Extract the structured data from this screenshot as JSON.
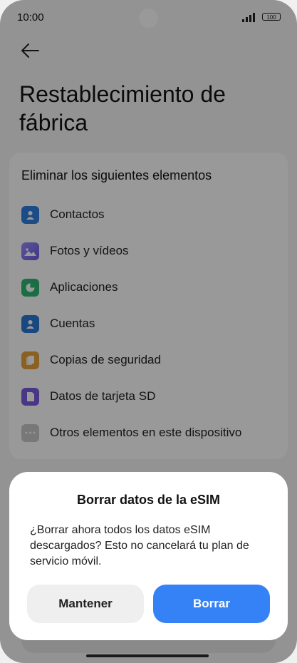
{
  "status_bar": {
    "time": "10:00",
    "battery": "100"
  },
  "header": {
    "title": "Restablecimiento de fábrica"
  },
  "card": {
    "title": "Eliminar los siguientes elementos",
    "items": [
      {
        "label": "Contactos",
        "icon": "contact-icon",
        "color": "#2f7fe0"
      },
      {
        "label": "Fotos y vídeos",
        "icon": "gallery-icon",
        "color": "#7b6df0"
      },
      {
        "label": "Aplicaciones",
        "icon": "apps-pie-icon",
        "color": "#2eb872"
      },
      {
        "label": "Cuentas",
        "icon": "account-icon",
        "color": "#2a78d6"
      },
      {
        "label": "Copias de seguridad",
        "icon": "backup-icon",
        "color": "#e8a23a"
      },
      {
        "label": "Datos de tarjeta SD",
        "icon": "sd-card-icon",
        "color": "#7a5ae0"
      },
      {
        "label": "Otros elementos en este dispositivo",
        "icon": "more-dots-icon",
        "color": "#c9c9c9"
      }
    ]
  },
  "dialog": {
    "title": "Borrar datos de la eSIM",
    "message": "¿Borrar ahora todos los datos eSIM descargados? Esto no cancelará tu plan de servicio móvil.",
    "keep_label": "Mantener",
    "delete_label": "Borrar"
  }
}
